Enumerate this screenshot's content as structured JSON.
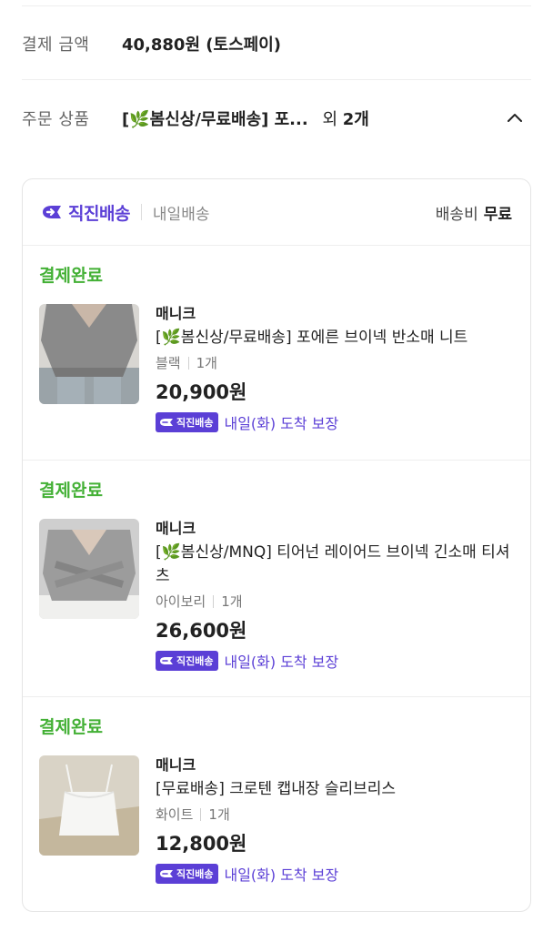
{
  "payment": {
    "label": "결제 금액",
    "value": "40,880원 (토스페이)"
  },
  "order": {
    "label": "주문 상품",
    "name": "[🌿봄신상/무료배송] 포...",
    "extra_prefix": "외",
    "extra_count": "2개"
  },
  "shipping": {
    "brand": "직진배송",
    "sub": "내일배송",
    "fee_label": "배송비",
    "fee_value": "무료"
  },
  "items": [
    {
      "status": "결제완료",
      "brand": "매니크",
      "name": "[🌿봄신상/무료배송] 포에른 브이넥 반소매 니트",
      "option": "블랙",
      "qty": "1개",
      "price": "20,900원",
      "badge": "직진배송",
      "arrival": "내일(화) 도착 보장"
    },
    {
      "status": "결제완료",
      "brand": "매니크",
      "name": "[🌿봄신상/MNQ] 티어넌 레이어드 브이넥 긴소매 티셔츠",
      "option": "아이보리",
      "qty": "1개",
      "price": "26,600원",
      "badge": "직진배송",
      "arrival": "내일(화) 도착 보장"
    },
    {
      "status": "결제완료",
      "brand": "매니크",
      "name": "[무료배송] 크로텐 캡내장 슬리브리스",
      "option": "화이트",
      "qty": "1개",
      "price": "12,800원",
      "badge": "직진배송",
      "arrival": "내일(화) 도착 보장"
    }
  ],
  "colors": {
    "accent": "#5b3fd6",
    "status": "#43b035"
  }
}
